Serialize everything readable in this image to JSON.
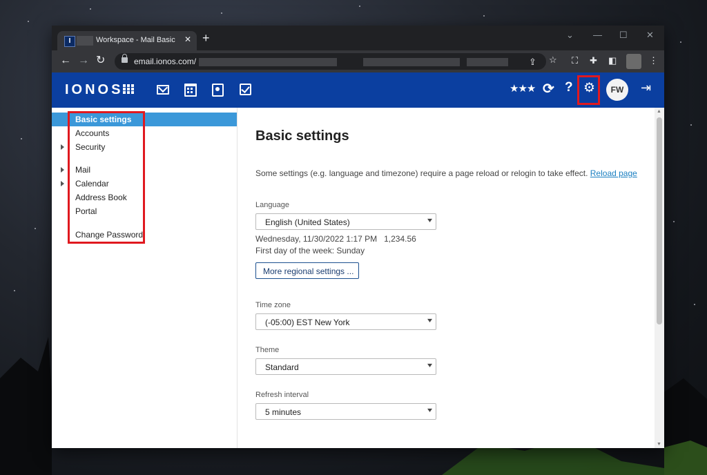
{
  "browser": {
    "tab_title": "Workspace - Mail Basic",
    "tab_favicon": "I",
    "tab_close": "✕",
    "new_tab": "+",
    "url": "email.ionos.com/",
    "icons": [
      "back-icon",
      "forward-icon",
      "reload-icon",
      "lock-icon",
      "share-icon",
      "star-icon",
      "screenshot-icon",
      "extensions-icon",
      "sidepanel-icon",
      "menu-icon"
    ]
  },
  "header": {
    "logo": "IONOS",
    "avatar_initials": "FW",
    "icons": [
      "apps-grid-icon",
      "mail-icon",
      "calendar-icon",
      "address-book-icon",
      "tasks-icon",
      "rating-stars-icon",
      "refresh-icon",
      "help-icon",
      "settings-gear-icon",
      "logout-icon"
    ]
  },
  "sidebar": {
    "items": [
      {
        "label": "Basic settings",
        "active": true,
        "expandable": false
      },
      {
        "label": "Accounts",
        "active": false,
        "expandable": false
      },
      {
        "label": "Security",
        "active": false,
        "expandable": true
      },
      {
        "label": "Mail",
        "active": false,
        "expandable": true
      },
      {
        "label": "Calendar",
        "active": false,
        "expandable": true
      },
      {
        "label": "Address Book",
        "active": false,
        "expandable": false
      },
      {
        "label": "Portal",
        "active": false,
        "expandable": false
      },
      {
        "label": "Change Password",
        "active": false,
        "expandable": false
      }
    ]
  },
  "main": {
    "title": "Basic settings",
    "note": "Some settings (e.g. language and timezone) require a page reload or relogin to take effect.",
    "reload_link": "Reload page",
    "language": {
      "label": "Language",
      "value": "English (United States)"
    },
    "locale_example": "Wednesday, 11/30/2022 1:17 PM   1,234.56",
    "first_day": "First day of the week: Sunday",
    "regional_button": "More regional settings ...",
    "timezone": {
      "label": "Time zone",
      "value": "(-05:00) EST New York"
    },
    "theme": {
      "label": "Theme",
      "value": "Standard"
    },
    "refresh": {
      "label": "Refresh interval",
      "value": "5 minutes"
    }
  },
  "colors": {
    "header_bg": "#0b3fa0",
    "active_item": "#3b98d9",
    "highlight_box": "#e0191f",
    "link": "#1a7fc1"
  }
}
